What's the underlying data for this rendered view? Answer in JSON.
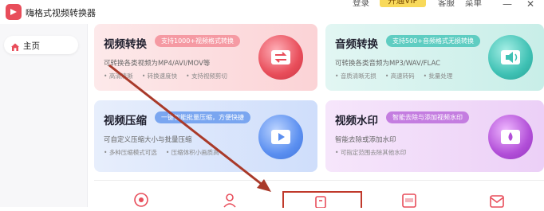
{
  "app": {
    "title": "嗨格式视频转换器"
  },
  "top_menu": {
    "login": "登录",
    "vip": "开通VIP",
    "service": "客服",
    "menu": "菜单"
  },
  "sidebar": {
    "items": [
      {
        "label": "主页",
        "icon": "home-icon"
      }
    ]
  },
  "cards": [
    {
      "title": "视频转换",
      "badge": "支持1000+视频格式转换",
      "desc": "可转换各类视频为MP4/AVI/MOV等",
      "features": [
        "高清清晰",
        "转换速度快",
        "支持视频剪切"
      ],
      "icon": "video-convert-icon"
    },
    {
      "title": "音频转换",
      "badge": "支持500+音频格式无损转换",
      "desc": "可转换各类音频为MP3/WAV/FLAC",
      "features": [
        "音质清晰无损",
        "高速转码",
        "批量处理"
      ],
      "icon": "audio-convert-icon"
    },
    {
      "title": "视频压缩",
      "badge": "一键智能批量压缩，方便快捷",
      "desc": "可自定义压缩大小与批量压缩",
      "features": [
        "多种压缩模式可选",
        "压缩体积小画质高"
      ],
      "icon": "video-compress-icon"
    },
    {
      "title": "视频水印",
      "badge": "智能去除与添加视频水印",
      "desc": "智能去除或添加水印",
      "features": [
        "可指定范围去除其他水印"
      ],
      "icon": "watermark-icon"
    }
  ],
  "colors": {
    "accent_red": "#c0392b",
    "brand": "#e84d5a",
    "vip": "#f8d95a"
  }
}
